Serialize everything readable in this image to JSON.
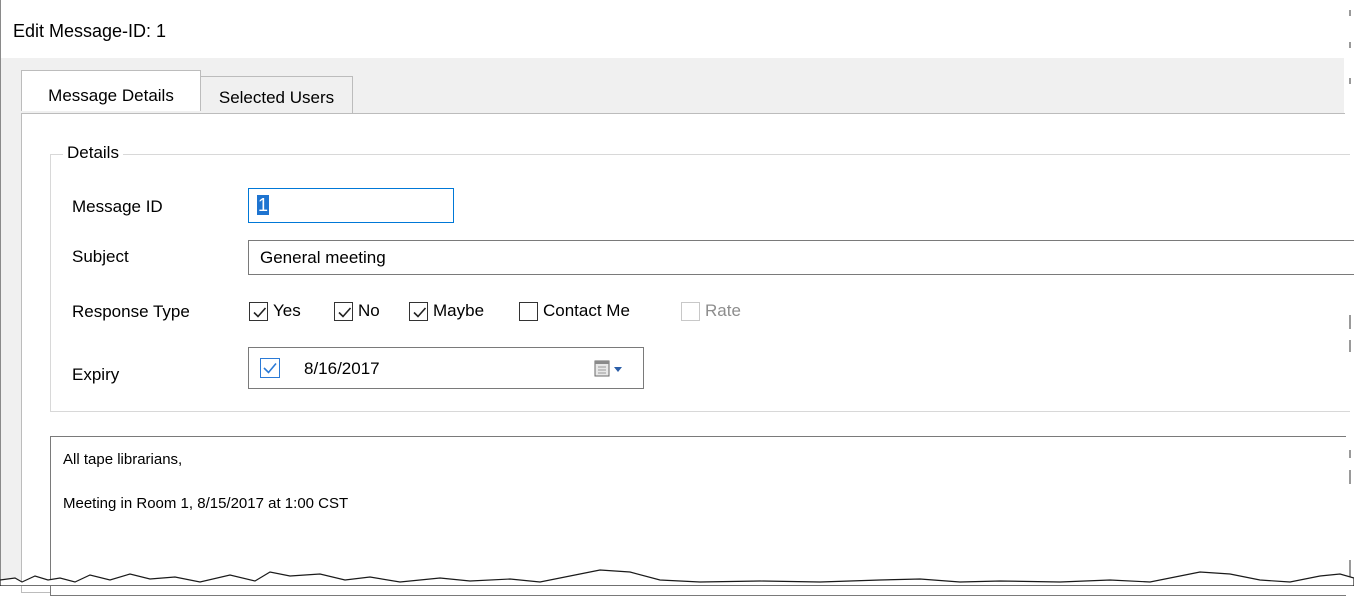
{
  "window": {
    "title": "Edit Message-ID: 1"
  },
  "tabs": [
    {
      "label": "Message Details",
      "active": true
    },
    {
      "label": "Selected Users",
      "active": false
    }
  ],
  "details": {
    "group_title": "Details",
    "message_id": {
      "label": "Message ID",
      "value": "1"
    },
    "subject": {
      "label": "Subject",
      "value": "General meeting"
    },
    "response_type": {
      "label": "Response Type",
      "options": [
        {
          "label": "Yes",
          "checked": true,
          "enabled": true
        },
        {
          "label": "No",
          "checked": true,
          "enabled": true
        },
        {
          "label": "Maybe",
          "checked": true,
          "enabled": true
        },
        {
          "label": "Contact Me",
          "checked": false,
          "enabled": true
        },
        {
          "label": "Rate",
          "checked": false,
          "enabled": false
        }
      ]
    },
    "expiry": {
      "label": "Expiry",
      "enabled": true,
      "date": "8/16/2017"
    }
  },
  "message_body": {
    "lines": [
      "All tape librarians,",
      "Meeting in Room 1, 8/15/2017 at 1:00 CST"
    ]
  },
  "colors": {
    "focus_border": "#0078d7",
    "selection": "#1e74d0",
    "panel_bg": "#ffffff",
    "window_bg": "#f0f0f0"
  }
}
